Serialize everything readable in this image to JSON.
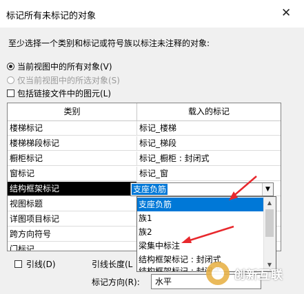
{
  "dialog": {
    "title": "标记所有未标记的对象",
    "close_glyph": "✕",
    "instruction": "至少选择一个类别和标记或符号族以标注未注释的对象:"
  },
  "options": {
    "all_in_view": "当前视图中的所有对象(V)",
    "selected_in_view": "仅当前视图中的所选对象(S)",
    "include_linked": "包括链接文件中的图元(L)"
  },
  "table": {
    "col_category": "类别",
    "col_tag": "载入的标记",
    "rows": [
      {
        "category": "楼梯标记",
        "tag": "标记_楼梯"
      },
      {
        "category": "楼梯梯段标记",
        "tag": "标记_梯段"
      },
      {
        "category": "橱柜标记",
        "tag": "标记_橱柜 : 封闭式"
      },
      {
        "category": "窗标记",
        "tag": "标记_窗"
      },
      {
        "category": "结构框架标记",
        "tag": ""
      },
      {
        "category": "视图标题",
        "tag": ""
      },
      {
        "category": "详图项目标记",
        "tag": ""
      },
      {
        "category": "跨方向符号",
        "tag": ""
      },
      {
        "category": "门标记",
        "tag": ""
      }
    ],
    "selected_row_index": 4
  },
  "combo": {
    "value": "支座负筋"
  },
  "dropdown": {
    "items": [
      "支座负筋",
      "族1",
      "族2",
      "梁集中标注",
      "结构框架标记 : 封闭式",
      "结构框架标记 : 封闭式"
    ],
    "highlighted_index": 0
  },
  "footer": {
    "leader_label": "引线(D)",
    "leader_length_label": "引线长度(L",
    "tag_orientation_label": "标记方向(R):",
    "tag_orientation_value": "水平"
  },
  "watermark": {
    "text": "创新互联"
  },
  "colors": {
    "selection": "#0078d7",
    "annotation_arrow": "#e8282d"
  },
  "icons": [
    "close-icon",
    "radio-icon",
    "checkbox-icon",
    "dropdown-arrow-icon",
    "scroll-up-icon",
    "scroll-down-icon",
    "annotation-arrow-icon",
    "watermark-logo-icon"
  ]
}
